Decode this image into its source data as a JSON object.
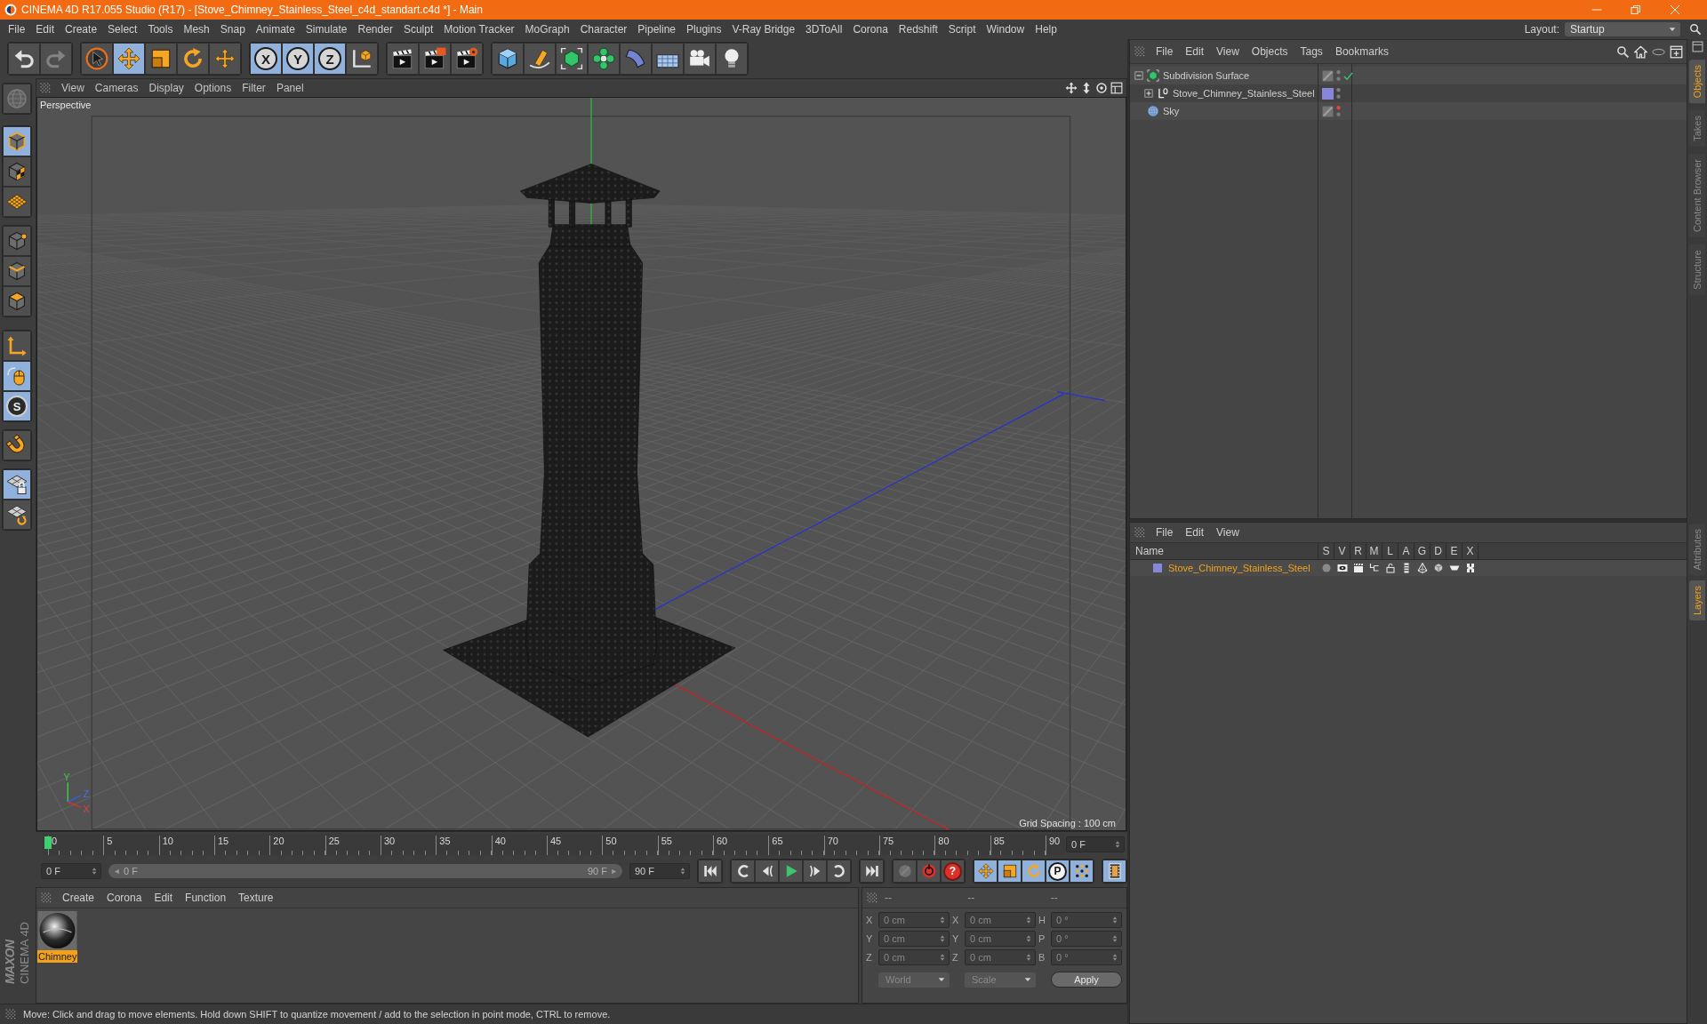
{
  "window": {
    "title": "CINEMA 4D R17.055 Studio (R17) - [Stove_Chimney_Stainless_Steel_c4d_standart.c4d *] - Main"
  },
  "menu_bar": {
    "items": [
      "File",
      "Edit",
      "Create",
      "Select",
      "Tools",
      "Mesh",
      "Snap",
      "Animate",
      "Simulate",
      "Render",
      "Sculpt",
      "Motion Tracker",
      "MoGraph",
      "Character",
      "Pipeline",
      "Plugins",
      "V-Ray Bridge",
      "3DToAll",
      "Corona",
      "Redshift",
      "Script",
      "Window",
      "Help"
    ],
    "layout_label": "Layout:",
    "layout_value": "Startup"
  },
  "toolbar": {
    "groups": [
      [
        {
          "selected": false,
          "disabled": false
        },
        {
          "selected": false,
          "disabled": true
        }
      ],
      [
        {
          "selected": false,
          "disabled": false
        },
        {
          "selected": true,
          "disabled": false
        },
        {
          "selected": false,
          "disabled": false
        },
        {
          "selected": false,
          "disabled": false
        },
        {
          "selected": false,
          "disabled": false
        }
      ],
      [
        {
          "label": "X",
          "selected": true,
          "disabled": false
        },
        {
          "label": "Y",
          "selected": true,
          "disabled": false
        },
        {
          "label": "Z",
          "selected": true,
          "disabled": false
        },
        {
          "selected": false,
          "disabled": false
        }
      ],
      [
        {
          "selected": false,
          "disabled": false
        },
        {
          "selected": false,
          "disabled": false
        },
        {
          "selected": false,
          "disabled": false
        }
      ],
      [
        {
          "selected": false,
          "disabled": false
        },
        {
          "selected": false,
          "disabled": false
        },
        {
          "selected": false,
          "disabled": false
        },
        {
          "selected": false,
          "disabled": false
        },
        {
          "selected": false,
          "disabled": false
        },
        {
          "selected": false,
          "disabled": false
        },
        {
          "selected": false,
          "disabled": false
        },
        {
          "selected": false,
          "disabled": false
        }
      ]
    ]
  },
  "tool_palette": {
    "groups": [
      [
        {
          "selected": false,
          "disabled": true
        }
      ],
      [
        {
          "selected": true,
          "disabled": false
        },
        {
          "selected": false,
          "disabled": false
        },
        {
          "selected": false,
          "disabled": false
        }
      ],
      [
        {
          "selected": false,
          "disabled": false
        },
        {
          "selected": false,
          "disabled": false
        },
        {
          "selected": false,
          "disabled": false
        }
      ],
      [
        {
          "selected": false,
          "disabled": false
        },
        {
          "selected": true,
          "disabled": false
        },
        {
          "label": "S",
          "selected": true,
          "disabled": false
        }
      ],
      [
        {
          "selected": false,
          "disabled": false
        }
      ],
      [
        {
          "selected": true,
          "disabled": false
        },
        {
          "selected": false,
          "disabled": false
        }
      ]
    ]
  },
  "viewport": {
    "menu": [
      "View",
      "Cameras",
      "Display",
      "Options",
      "Filter",
      "Panel"
    ],
    "camera": "Perspective",
    "grid_spacing": "Grid Spacing : 100 cm",
    "axis_labels": [
      "Y",
      "Z",
      "X"
    ]
  },
  "timeline": {
    "ticks": [
      "0",
      "5",
      "10",
      "15",
      "20",
      "25",
      "30",
      "35",
      "40",
      "45",
      "50",
      "55",
      "60",
      "65",
      "70",
      "75",
      "80",
      "85",
      "90"
    ],
    "level": 0,
    "current_frame": "0 F"
  },
  "transport": {
    "start_frame": "0 F",
    "range": {
      "start": "0 F",
      "end": "90 F",
      "level": 1
    },
    "end_frame": "90 F",
    "groups": [
      [
        {
          "selected": false,
          "disabled": false
        }
      ],
      [
        {
          "selected": false,
          "disabled": false
        },
        {
          "selected": false,
          "disabled": false
        },
        {
          "selected": false,
          "disabled": false
        },
        {
          "selected": false,
          "disabled": false
        },
        {
          "selected": false,
          "disabled": false
        }
      ],
      [
        {
          "selected": false,
          "disabled": false
        }
      ],
      [
        {
          "selected": false,
          "disabled": true
        },
        {
          "selected": false,
          "disabled": false
        },
        {
          "label": "?",
          "selected": false,
          "disabled": false
        }
      ],
      [
        {
          "selected": true,
          "disabled": false
        },
        {
          "selected": true,
          "disabled": false
        },
        {
          "selected": true,
          "disabled": false
        },
        {
          "label": "P",
          "selected": true,
          "disabled": false
        },
        {
          "selected": true,
          "disabled": false
        }
      ],
      [
        {
          "selected": true,
          "disabled": false
        }
      ]
    ]
  },
  "materials": {
    "menu": [
      "Create",
      "Corona",
      "Edit",
      "Function",
      "Texture"
    ],
    "items": [
      {
        "name": "Chimney",
        "selected": true
      }
    ]
  },
  "coordinates": {
    "headers": [
      "--",
      "--",
      "--"
    ],
    "rows": [
      {
        "position_axis": "X",
        "position": "0 cm",
        "size_axis": "X",
        "size": "0 cm",
        "rotation_axis": "H",
        "rotation": "0 °"
      },
      {
        "position_axis": "Y",
        "position": "0 cm",
        "size_axis": "Y",
        "size": "0 cm",
        "rotation_axis": "P",
        "rotation": "0 °"
      },
      {
        "position_axis": "Z",
        "position": "0 cm",
        "size_axis": "Z",
        "size": "0 cm",
        "rotation_axis": "B",
        "rotation": "0 °"
      }
    ],
    "position_mode": "World",
    "size_mode": "Scale",
    "apply": "Apply"
  },
  "objects": {
    "menu": [
      "File",
      "Edit",
      "View",
      "Objects",
      "Tags",
      "Bookmarks"
    ],
    "tree": [
      {
        "name": "Subdivision Surface",
        "kind": "subdivision",
        "has_children": true,
        "expanded": true,
        "enabled": true,
        "hidden_in_editor": false,
        "children": [
          {
            "name": "Stove_Chimney_Stainless_Steel",
            "kind": "null",
            "has_children": true,
            "expanded": false,
            "enabled": false,
            "hidden_in_editor": false,
            "color": "#8886d8"
          }
        ]
      },
      {
        "name": "Sky",
        "kind": "sky",
        "has_children": false,
        "expanded": false,
        "enabled": false,
        "hidden_in_editor": true
      }
    ]
  },
  "layers": {
    "menu": [
      "File",
      "Edit",
      "View"
    ],
    "columns": [
      "Name",
      "S",
      "V",
      "R",
      "M",
      "L",
      "A",
      "G",
      "D",
      "E",
      "X"
    ],
    "items": [
      {
        "name": "Stove_Chimney_Stainless_Steel",
        "color": "#8886d8",
        "selected": true
      }
    ]
  },
  "side_tabs": {
    "top": [
      {
        "label": "Objects",
        "selected": true
      },
      {
        "label": "Takes",
        "selected": false
      },
      {
        "label": "Content Browser",
        "selected": false
      },
      {
        "label": "Structure",
        "selected": false
      }
    ],
    "bottom": [
      {
        "label": "Attributes",
        "selected": false
      },
      {
        "label": "Layers",
        "selected": true
      }
    ]
  },
  "status_bar": {
    "text": "Move: Click and drag to move elements. Hold down SHIFT to quantize movement / add to the selection in point mode, CTRL to remove."
  },
  "logo": {
    "brand": "MAXON",
    "product": "CINEMA 4D"
  }
}
